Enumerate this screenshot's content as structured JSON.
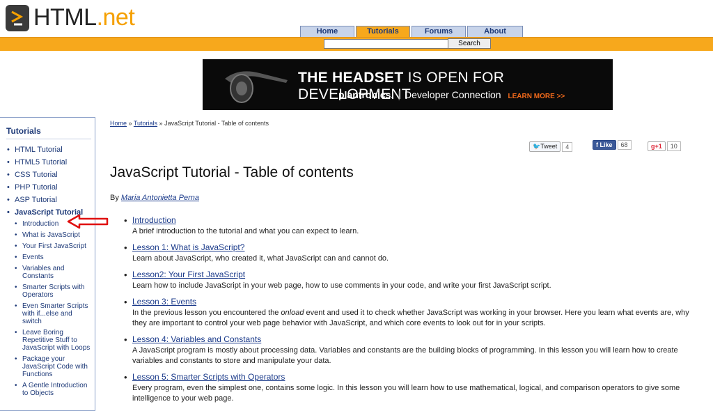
{
  "header": {
    "logo_text_1": "HTML",
    "logo_text_2": ".net",
    "tabs": [
      "Home",
      "Tutorials",
      "Forums",
      "About"
    ],
    "active_tab": "Tutorials",
    "search": {
      "value": "",
      "button_label": "Search"
    }
  },
  "banner": {
    "headline_bold": "THE HEADSET",
    "headline_rest": "IS OPEN FOR DEVELOPMENT",
    "brand": "plantronics.",
    "sub": "Developer Connection",
    "cta": "LEARN MORE >>"
  },
  "sidebar": {
    "title": "Tutorials",
    "items": [
      "HTML Tutorial",
      "HTML5 Tutorial",
      "CSS Tutorial",
      "PHP Tutorial",
      "ASP Tutorial",
      "JavaScript Tutorial"
    ],
    "subitems": [
      "Introduction",
      "What is JavaScript",
      "Your First JavaScript",
      "Events",
      "Variables and Constants",
      "Smarter Scripts with Operators",
      "Even Smarter Scripts with if...else and switch",
      "Leave Boring Repetitive Stuff to JavaScript with Loops",
      "Package your JavaScript Code with Functions",
      "A Gentle Introduction to Objects"
    ]
  },
  "breadcrumb": {
    "home": "Home",
    "sep1": " » ",
    "tutorials": "Tutorials",
    "sep2": " » ",
    "current": "JavaScript Tutorial - Table of contents"
  },
  "social": {
    "tweet": "Tweet",
    "tweet_count": "4",
    "like": "Like",
    "like_count": "68",
    "gplus": "g+1",
    "gplus_count": "10"
  },
  "page": {
    "title": "JavaScript Tutorial - Table of contents",
    "by": "By ",
    "author": "Maria Antonietta Perna"
  },
  "lessons": [
    {
      "title": "Introduction",
      "desc_before": "A brief introduction to the tutorial and what you can expect to learn.",
      "em": "",
      "desc_after": ""
    },
    {
      "title": "Lesson 1: What is JavaScript?",
      "desc_before": "Learn about JavaScript, who created it, what JavaScript can and cannot do.",
      "em": "",
      "desc_after": ""
    },
    {
      "title": "Lesson2: Your First JavaScript",
      "desc_before": "Learn how to include JavaScript in your web page, how to use comments in your code, and write your first JavaScript script.",
      "em": "",
      "desc_after": ""
    },
    {
      "title": "Lesson 3: Events",
      "desc_before": "In the previous lesson you encountered the ",
      "em": "onload",
      "desc_after": " event and used it to check whether JavaScript was working in your browser. Here you learn what events are, why they are important to control your web page behavior with JavaScript, and which core events to look out for in your scripts."
    },
    {
      "title": "Lesson 4: Variables and Constants",
      "desc_before": "A JavaScript program is mostly about processing data. Variables and constants are the building blocks of programming. In this lesson you will learn how to create variables and constants to store and manipulate your data.",
      "em": "",
      "desc_after": ""
    },
    {
      "title": "Lesson 5: Smarter Scripts with Operators",
      "desc_before": "Every program, even the simplest one, contains some logic. In this lesson you will learn how to use mathematical, logical, and comparison operators to give some intelligence to your web page.",
      "em": "",
      "desc_after": ""
    }
  ]
}
